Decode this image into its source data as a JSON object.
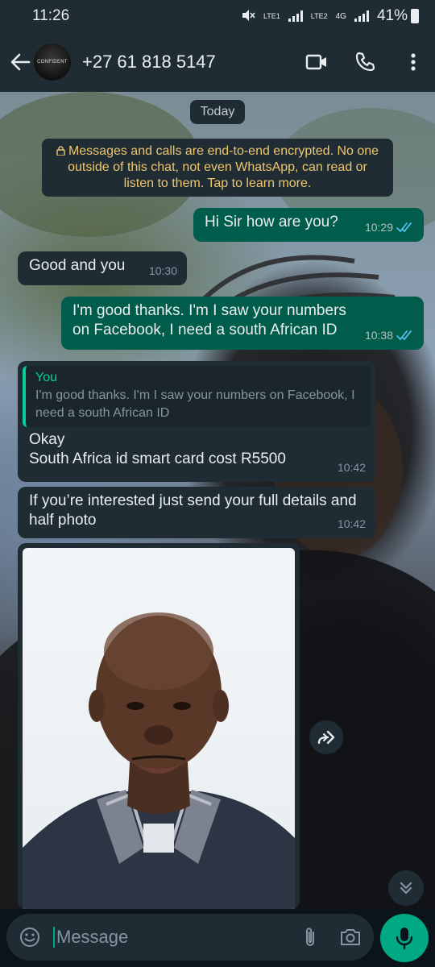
{
  "status_bar": {
    "time": "11:26",
    "network1": "LTE1",
    "network2": "LTE2",
    "network_type": "4G",
    "battery": "41%"
  },
  "header": {
    "avatar_text": "CONFIDENT",
    "contact_name": "+27 61 818 5147"
  },
  "chat": {
    "date_label": "Today",
    "encryption_notice": "Messages and calls are end-to-end encrypted. No one outside of this chat, not even WhatsApp, can read or listen to them. Tap to learn more.",
    "messages": [
      {
        "direction": "out",
        "text": "Hi Sir how are you?",
        "time": "10:29",
        "status": "read"
      },
      {
        "direction": "in",
        "text": "Good and you",
        "time": "10:30"
      },
      {
        "direction": "out",
        "text": "I'm good thanks. I'm I saw your numbers on Facebook, I need a south African ID",
        "time": "10:38",
        "status": "read"
      },
      {
        "direction": "in",
        "quote_author": "You",
        "quote_text": "I'm good thanks. I'm I saw your numbers on Facebook, I need a south African ID",
        "line1": "Okay",
        "line2": "South Africa id smart card cost R5500",
        "time": "10:42"
      },
      {
        "direction": "in",
        "text": "If you’re interested just send your full details and half photo",
        "time": "10:42"
      },
      {
        "direction": "in",
        "type": "photo"
      }
    ]
  },
  "input": {
    "placeholder": "Message"
  },
  "colors": {
    "outgoing_bubble": "#005c4b",
    "incoming_bubble": "#1f2c34",
    "accent": "#00a884",
    "notice_text": "#f0c66c",
    "read_ticks": "#53bdeb"
  }
}
